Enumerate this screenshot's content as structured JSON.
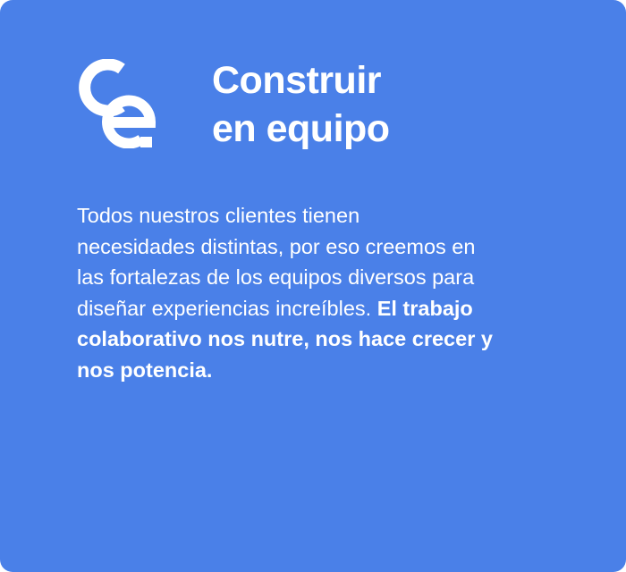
{
  "card": {
    "background": "#4a80e8",
    "logo_icon": "ce-logo-icon",
    "title_lines": [
      "Construir",
      "en equipo"
    ],
    "body": {
      "line1": "Todos nuestros clientes tienen",
      "line2": "necesidades distintas, por eso creemos en",
      "line3": "las fortalezas de los equipos diversos para",
      "line4_regular": "diseñar experiencias increíbles. ",
      "line4_bold": "El trabajo",
      "line5": "colaborativo nos nutre, nos hace crecer y",
      "line6": "nos potencia."
    }
  }
}
